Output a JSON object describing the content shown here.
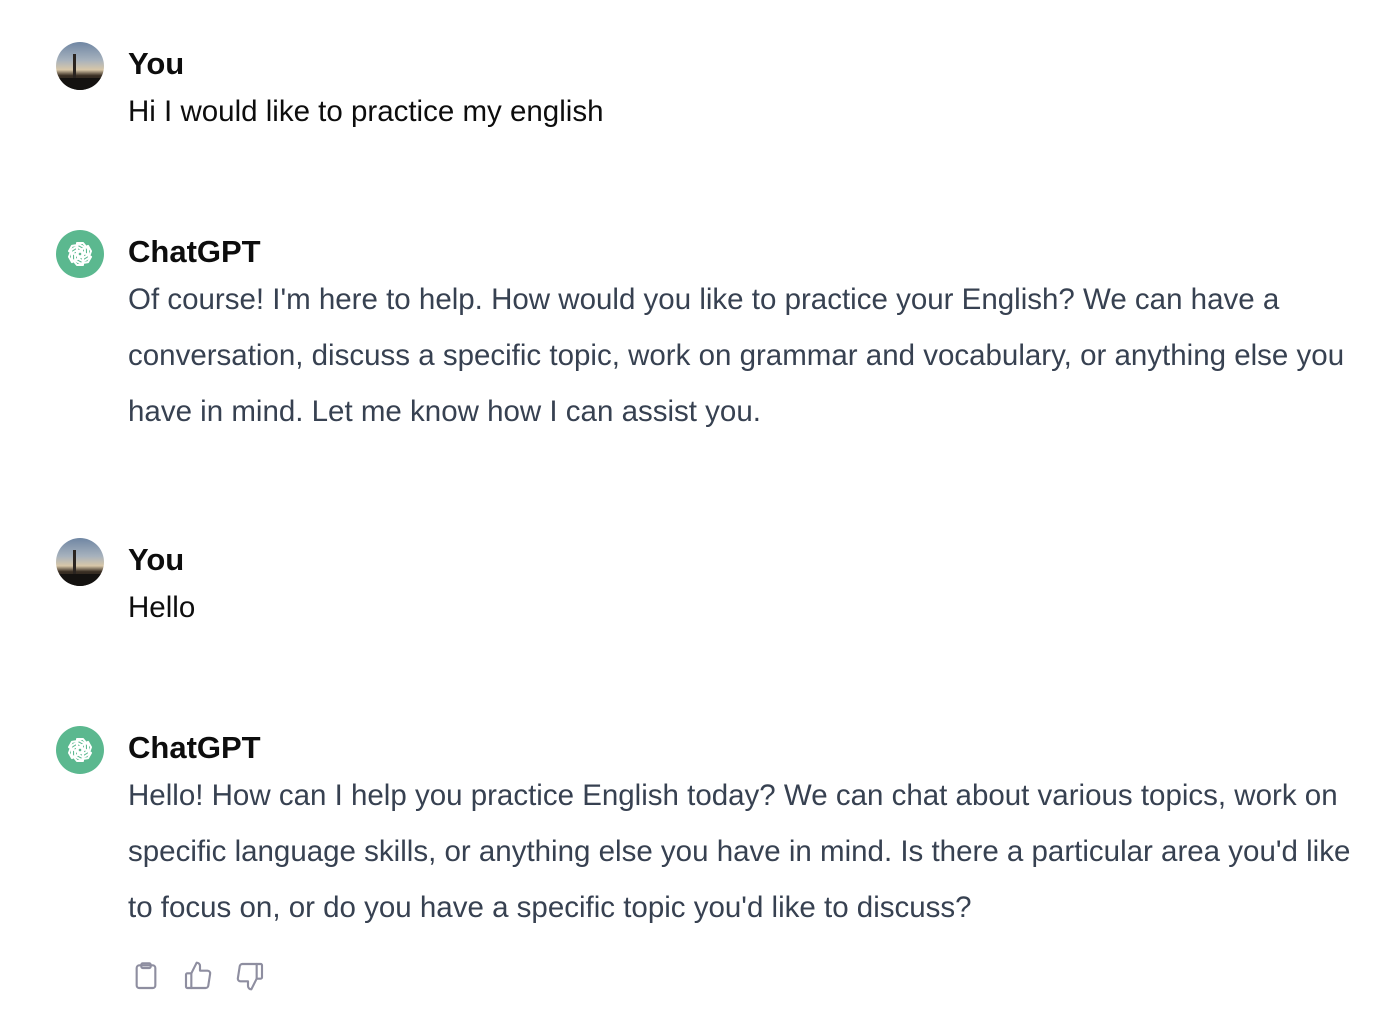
{
  "messages": [
    {
      "role": "user",
      "author": "You",
      "text": "Hi I would like to practice my english",
      "avatar_icon": "user-avatar-photo"
    },
    {
      "role": "assistant",
      "author": "ChatGPT",
      "text": "Of course! I'm here to help. How would you like to practice your English? We can have a conversation, discuss a specific topic, work on grammar and vocabulary, or anything else you have in mind. Let me know how I can assist you.",
      "avatar_icon": "openai-logo-icon"
    },
    {
      "role": "user",
      "author": "You",
      "text": "Hello",
      "avatar_icon": "user-avatar-photo"
    },
    {
      "role": "assistant",
      "author": "ChatGPT",
      "text": "Hello! How can I help you practice English today? We can chat about various topics, work on specific language skills, or anything else you have in mind. Is there a particular area you'd like to focus on, or do you have a specific topic you'd like to discuss?",
      "avatar_icon": "openai-logo-icon"
    }
  ],
  "actions": [
    {
      "icon": "clipboard-icon"
    },
    {
      "icon": "thumbs-up-icon"
    },
    {
      "icon": "thumbs-down-icon"
    }
  ],
  "colors": {
    "assistant_avatar_bg": "#5bb88f",
    "assistant_text": "#374151",
    "action_icon": "#8e8ea0"
  }
}
